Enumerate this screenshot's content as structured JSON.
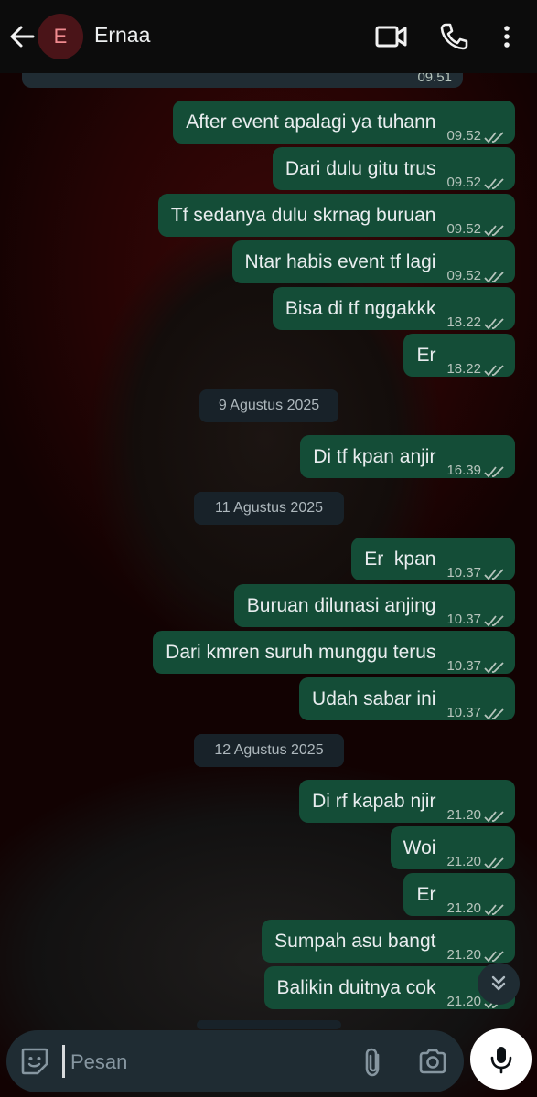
{
  "header": {
    "avatar_letter": "E",
    "contact_name": "Ernaa"
  },
  "colors": {
    "outgoing_bubble": "#144d37",
    "header_bg": "#0c0c0c",
    "tick": "#b7c5bd"
  },
  "partial_message": {
    "time": "09.51"
  },
  "messages": [
    {
      "text": "After event apalagi ya tuhann",
      "time": "09.52"
    },
    {
      "text": "Dari dulu gitu trus",
      "time": "09.52"
    },
    {
      "text": "Tf sedanya dulu skrnag buruan",
      "time": "09.52"
    },
    {
      "text": "Ntar habis event tf lagi",
      "time": "09.52"
    },
    {
      "text": "Bisa di tf nggakkk",
      "time": "18.22"
    },
    {
      "text": "Er",
      "time": "18.22"
    },
    {
      "text": "Di tf kpan anjir",
      "time": "16.39"
    },
    {
      "text": "Er  kpan",
      "time": "10.37"
    },
    {
      "text": "Buruan dilunasi anjing",
      "time": "10.37"
    },
    {
      "text": "Dari kmren suruh munggu terus",
      "time": "10.37"
    },
    {
      "text": "Udah sabar ini",
      "time": "10.37"
    },
    {
      "text": "Di rf kapab njir",
      "time": "21.20"
    },
    {
      "text": "Woi",
      "time": "21.20"
    },
    {
      "text": "Er",
      "time": "21.20"
    },
    {
      "text": "Sumpah asu bangt",
      "time": "21.20"
    },
    {
      "text": "Balikin duitnya cok",
      "time": "21.20"
    }
  ],
  "dates": [
    "9 Agustus 2025",
    "11 Agustus 2025",
    "12 Agustus 2025"
  ],
  "composer": {
    "placeholder": "Pesan"
  },
  "icons": [
    "back-arrow-icon",
    "video-call-icon",
    "phone-icon",
    "more-vert-icon",
    "sticker-icon",
    "paperclip-icon",
    "camera-icon",
    "mic-icon",
    "double-chevron-down-icon",
    "double-check-icon"
  ]
}
